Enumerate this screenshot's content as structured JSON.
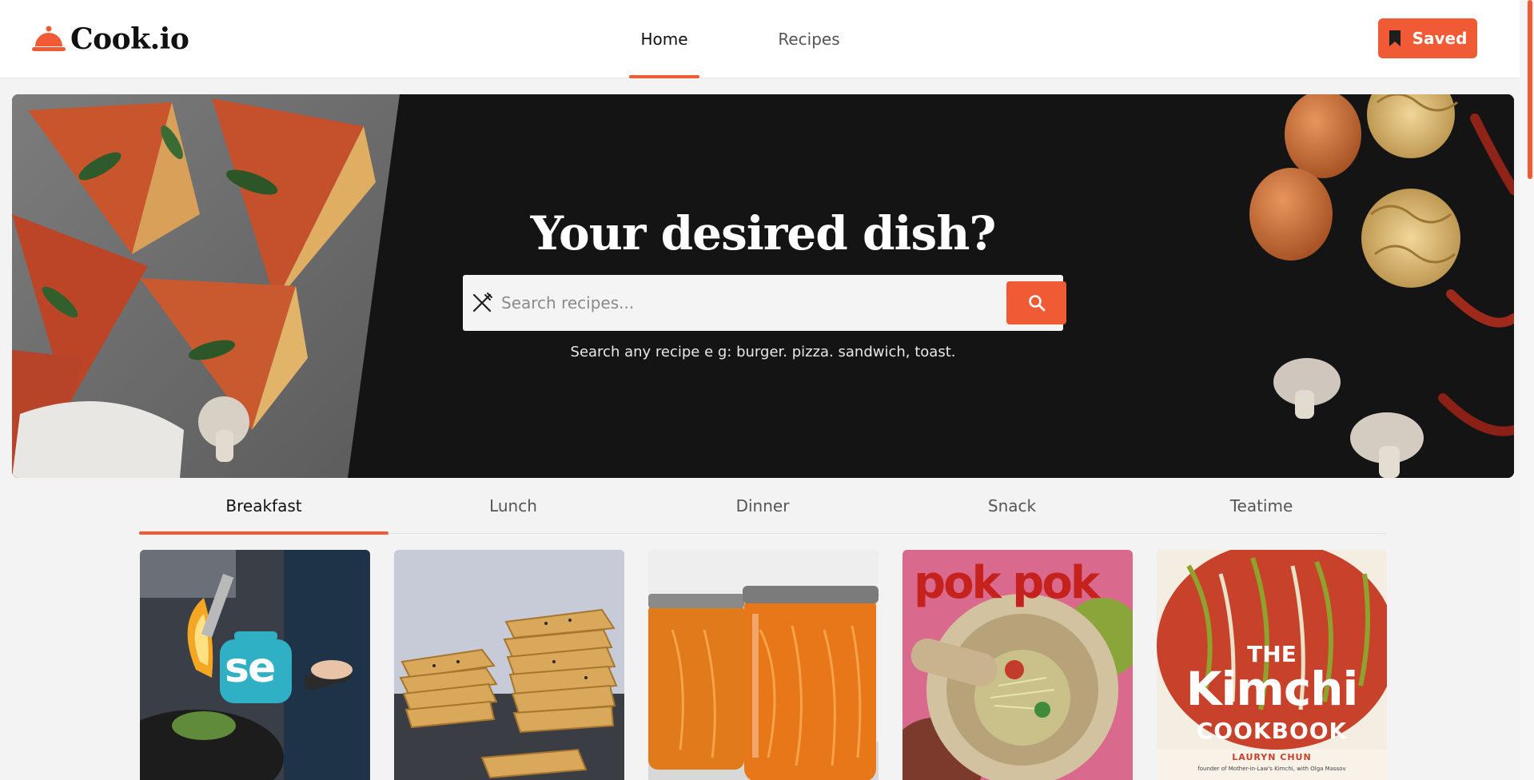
{
  "brand": {
    "name": "Cook.io",
    "accent": "#f05a35"
  },
  "nav": {
    "items": [
      {
        "label": "Home",
        "active": true
      },
      {
        "label": "Recipes",
        "active": false
      }
    ]
  },
  "saved_button": {
    "label": "Saved",
    "icon": "bookmark-icon"
  },
  "hero": {
    "title": "Your desired dish?",
    "search_placeholder": "Search recipes...",
    "search_value": "",
    "hint": "Search any recipe e g: burger. pizza. sandwich, toast.",
    "search_icon": "search-icon",
    "field_icon": "fork-knife-icon"
  },
  "tabs": [
    {
      "label": "Breakfast",
      "active": true
    },
    {
      "label": "Lunch",
      "active": false
    },
    {
      "label": "Dinner",
      "active": false
    },
    {
      "label": "Snack",
      "active": false
    },
    {
      "label": "Teatime",
      "active": false
    }
  ],
  "cards": [
    {
      "image": "wok-flame-serious-eats",
      "logo_text": "se"
    },
    {
      "image": "stacked-crackers"
    },
    {
      "image": "marmalade-jars"
    },
    {
      "image": "pok-pok-cookbook",
      "cover_text": "pok pok"
    },
    {
      "image": "kimchi-cookbook",
      "cover_title_1": "THE",
      "cover_title_2": "Kimchi",
      "cover_title_3": "COOKBOOK",
      "cover_author": "LAURYN CHUN",
      "cover_sub": "founder of Mother-in-Law's Kimchi, with Olga Massov"
    }
  ]
}
